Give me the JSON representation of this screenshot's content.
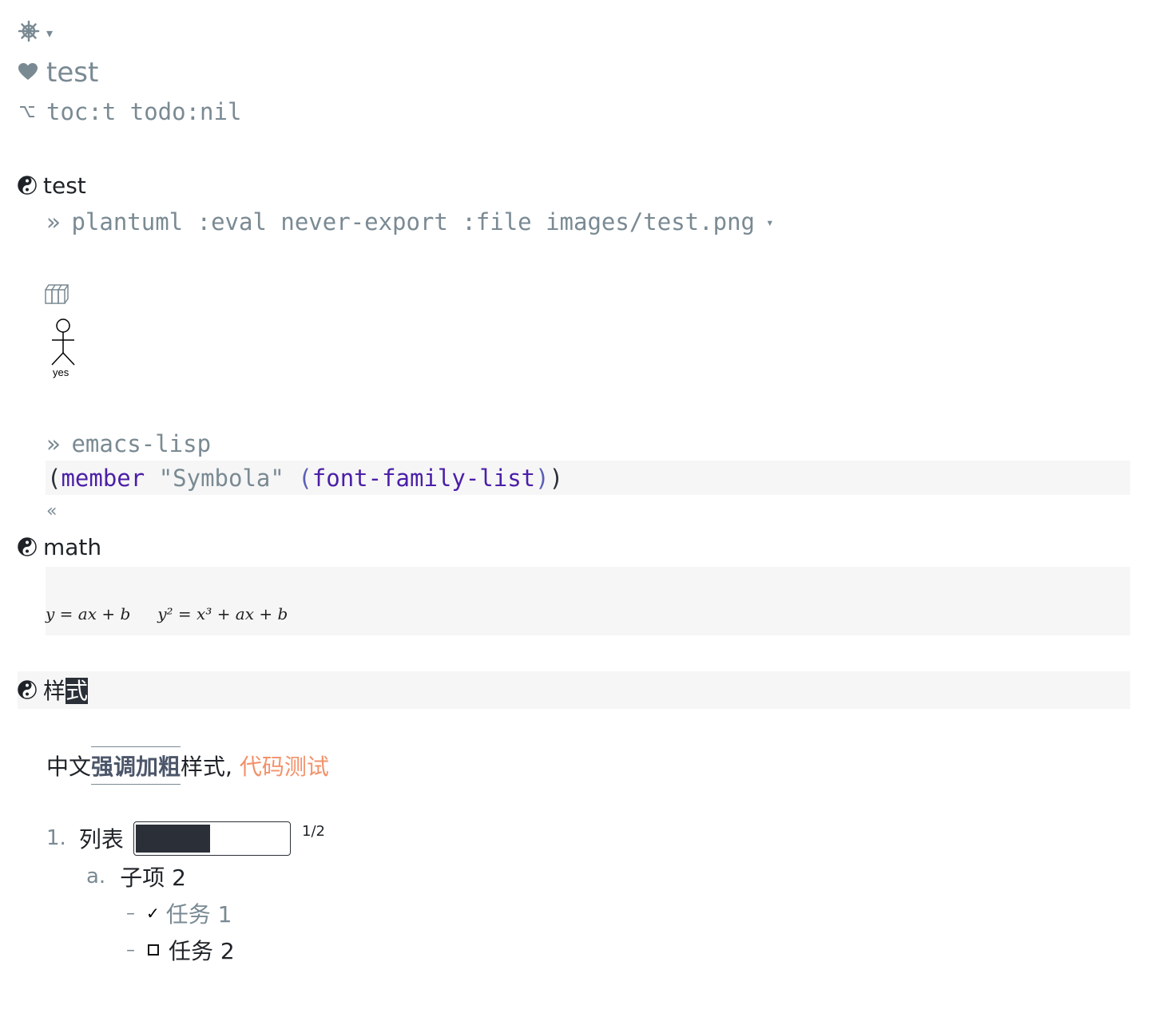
{
  "header": {
    "settings_icon": "helm-icon",
    "dropdown_glyph": "▾",
    "title_icon": "heart-icon",
    "title": "test",
    "options_icon": "option-key-icon",
    "options": "toc:t todo:nil"
  },
  "section_test": {
    "heading": "test",
    "src_prompt": "»",
    "src_header": "plantuml :eval never-export :file images/test.png",
    "src_dropdown": "▾",
    "image_caption": "yes"
  },
  "section_lisp": {
    "src_prompt": "»",
    "src_lang": "emacs-lisp",
    "code": {
      "open_paren": "(",
      "fn": "member",
      "string": "\"Symbola\"",
      "inner_open": "(",
      "inner_fn": "font-family-list",
      "inner_close": ")",
      "close_paren": ")"
    },
    "end_marker": "«"
  },
  "section_math": {
    "heading": "math",
    "formula_1": "y = ax + b",
    "formula_2_base": "y² = x³ + ax + b"
  },
  "section_style": {
    "heading_prefix": "样",
    "heading_cursor": "式",
    "para_prefix": "中文",
    "para_bold": "强调加粗",
    "para_middle": "样式, ",
    "para_code": "代码测试"
  },
  "list": {
    "item1_marker": "1.",
    "item1_label": "列表",
    "progress": 0.5,
    "progress_text": "1/2",
    "item_a_marker": "a.",
    "item_a_label": "子项 2",
    "task_dash": "–",
    "task1_check": "✓",
    "task1_label": "任务 1",
    "task2_label": "任务 2"
  },
  "colors": {
    "gray": "#7a8a93",
    "code_purple": "#4b1fa8",
    "code_orange": "#f2916a",
    "block_bg": "#f6f6f6"
  }
}
